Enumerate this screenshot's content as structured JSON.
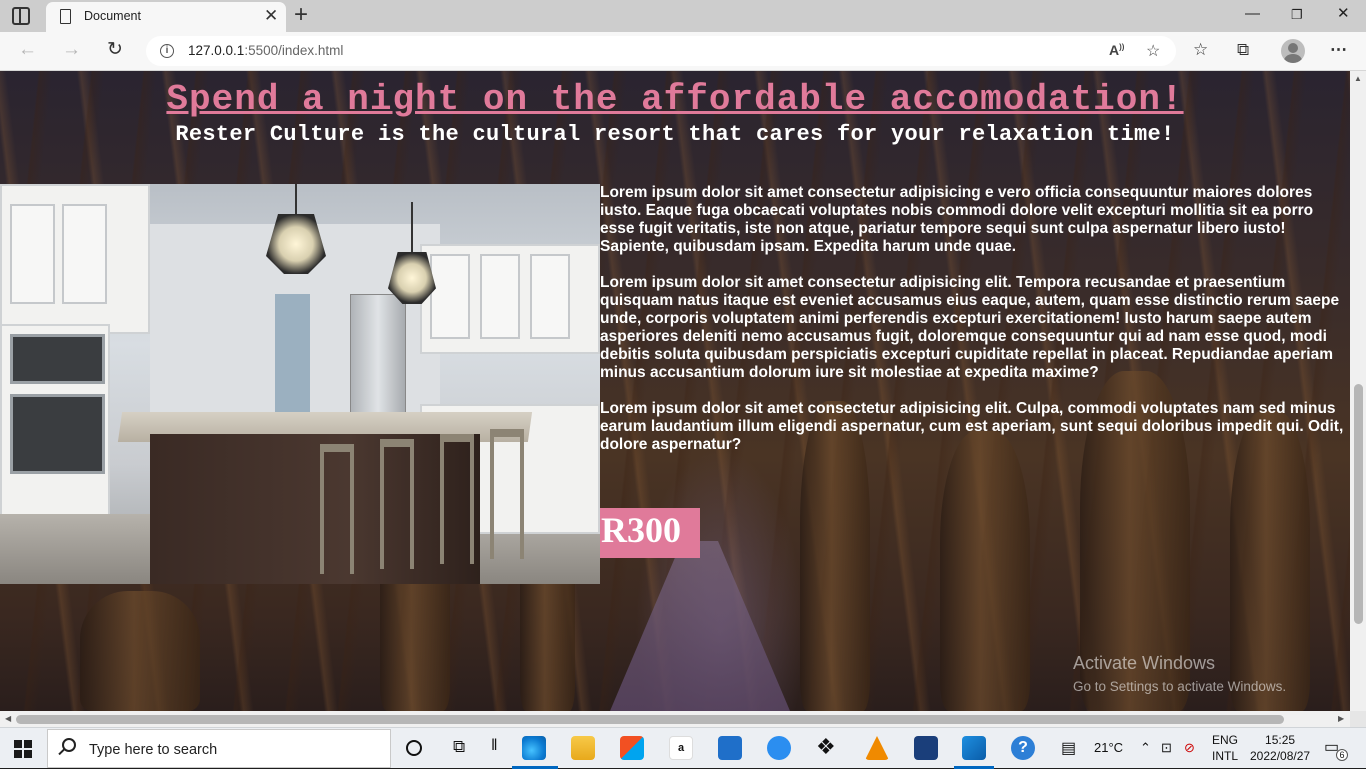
{
  "browser": {
    "tab_title": "Document",
    "url_host": "127.0.0.1",
    "url_rest": ":5500/index.html",
    "new_tab_glyph": "+",
    "close_glyph": "✕"
  },
  "page": {
    "headline": "Spend a night on the affordable accomodation!",
    "subline": "Rester Culture is the cultural resort that cares for your relaxation time!",
    "image_alt": "kitchen",
    "paragraphs": [
      "Lorem ipsum dolor sit amet consectetur adipisicing e vero officia consequuntur maiores dolores iusto. Eaque fuga obcaecati voluptates nobis commodi dolore velit excepturi mollitia sit ea porro esse fugit veritatis, iste non atque, pariatur tempore sequi sunt culpa aspernatur libero iusto! Sapiente, quibusdam ipsam. Expedita harum unde quae.",
      "Lorem ipsum dolor sit amet consectetur adipisicing elit. Tempora recusandae et praesentium quisquam natus itaque est eveniet accusamus eius eaque, autem, quam esse distinctio rerum saepe unde, corporis voluptatem animi perferendis excepturi exercitationem! Iusto harum saepe autem asperiores deleniti nemo accusamus fugit, doloremque consequuntur qui ad nam esse quod, modi debitis soluta quibusdam perspiciatis excepturi cupiditate repellat in placeat. Repudiandae aperiam minus accusantium dolorum iure sit molestiae at expedita maxime?",
      "Lorem ipsum dolor sit amet consectetur adipisicing elit. Culpa, commodi voluptates nam sed minus earum laudantium illum eligendi aspernatur, cum est aperiam, sunt sequi doloribus impedit qui. Odit, dolore aspernatur?"
    ],
    "price": "R300",
    "accent_color": "#e07a9a"
  },
  "watermark": {
    "line1": "Activate Windows",
    "line2": "Go to Settings to activate Windows."
  },
  "taskbar": {
    "search_placeholder": "Type here to search",
    "weather": "21°C",
    "lang_line1": "ENG",
    "lang_line2": "INTL",
    "time": "15:25",
    "date": "2022/08/27",
    "notification_count": "6"
  }
}
